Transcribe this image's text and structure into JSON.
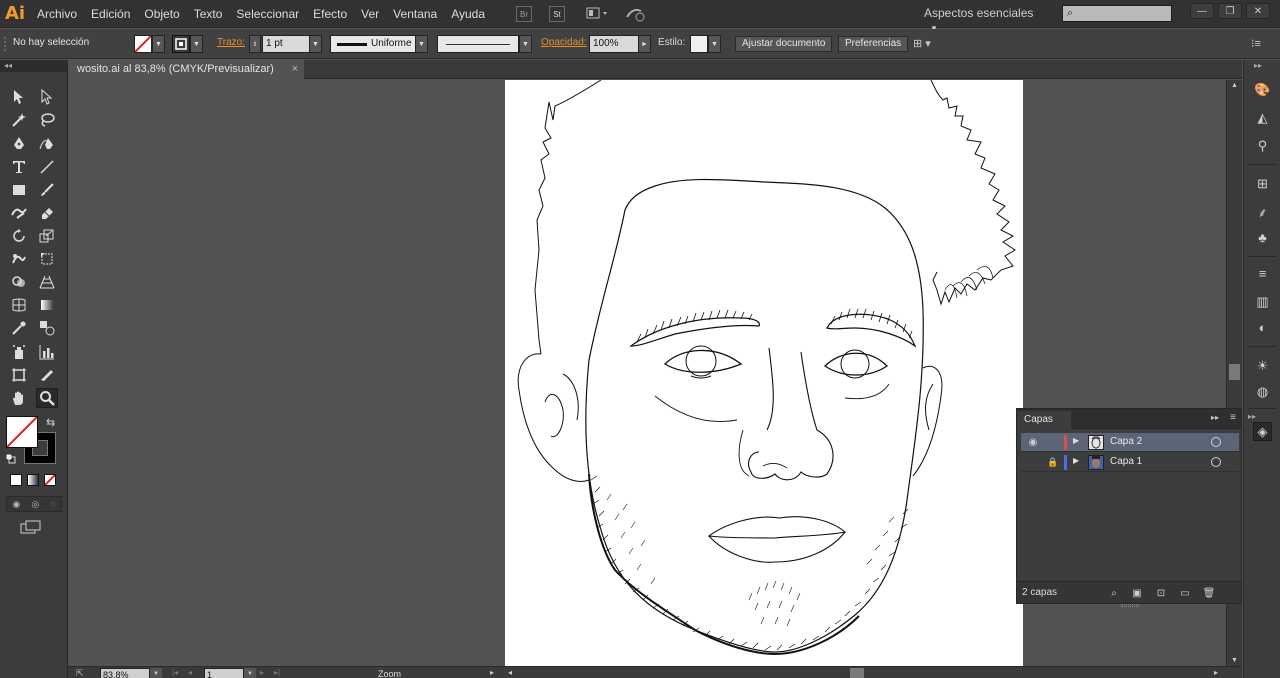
{
  "app": {
    "logo": "Ai"
  },
  "menu": [
    "Archivo",
    "Edición",
    "Objeto",
    "Texto",
    "Seleccionar",
    "Efecto",
    "Ver",
    "Ventana",
    "Ayuda"
  ],
  "menubar_icons": {
    "br": "Br",
    "st": "St"
  },
  "workspace": "Aspectos esenciales",
  "search": {
    "placeholder": ""
  },
  "control": {
    "selection": "No hay selección",
    "stroke_label": "Trazo:",
    "stroke_weight": "1 pt",
    "profile": "Uniforme",
    "opacity_label": "Opacidad:",
    "opacity_value": "100%",
    "style_label": "Estilo:",
    "adjust_doc": "Ajustar documento",
    "preferences": "Preferencias"
  },
  "document": {
    "tab_title": "wosito.ai al 83,8% (CMYK/Previsualizar)",
    "close_glyph": "×"
  },
  "statusbar": {
    "zoom": "83,8%",
    "page": "1",
    "tool": "Zoom"
  },
  "layers_panel": {
    "title": "Capas",
    "layers": [
      {
        "name": "Capa 2",
        "visible": true,
        "locked": false,
        "color": "#e04a4a",
        "selected": true
      },
      {
        "name": "Capa 1",
        "visible": false,
        "locked": true,
        "color": "#4a6de0",
        "selected": false
      }
    ],
    "count": "2 capas"
  },
  "colors": {
    "accent": "#e8912a",
    "selection": "#5c6578"
  }
}
